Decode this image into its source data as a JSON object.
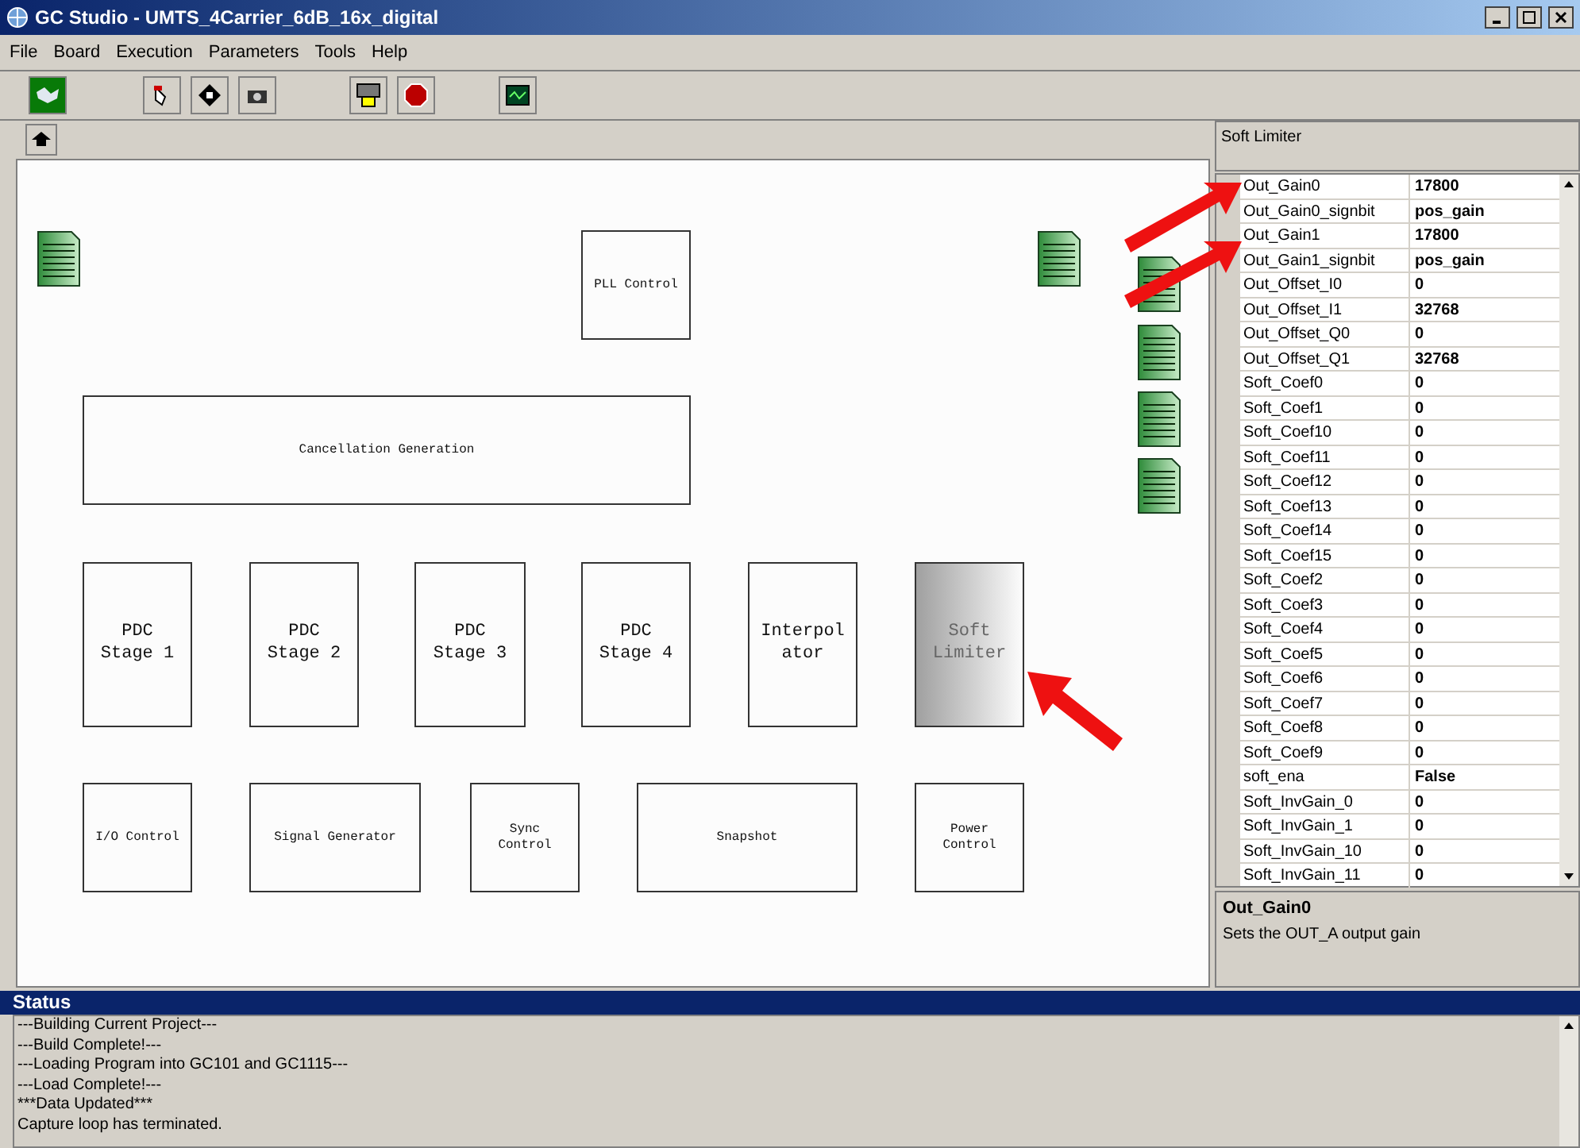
{
  "window": {
    "title": "GC Studio - UMTS_4Carrier_6dB_16x_digital"
  },
  "menu": [
    "File",
    "Board",
    "Execution",
    "Parameters",
    "Tools",
    "Help"
  ],
  "canvas": {
    "blocks": [
      {
        "kind": "small",
        "lines": [
          "PLL Control"
        ],
        "selected": false
      },
      {
        "kind": "small",
        "lines": [
          "Cancellation Generation"
        ],
        "selected": false
      },
      {
        "kind": "large",
        "lines": [
          "PDC",
          "Stage 1"
        ],
        "selected": false
      },
      {
        "kind": "large",
        "lines": [
          "PDC",
          "Stage 2"
        ],
        "selected": false
      },
      {
        "kind": "large",
        "lines": [
          "PDC",
          "Stage 3"
        ],
        "selected": false
      },
      {
        "kind": "large",
        "lines": [
          "PDC",
          "Stage 4"
        ],
        "selected": false
      },
      {
        "kind": "large",
        "lines": [
          "Interpol",
          "ator"
        ],
        "selected": false
      },
      {
        "kind": "large",
        "lines": [
          "Soft",
          "Limiter"
        ],
        "selected": true
      },
      {
        "kind": "small",
        "lines": [
          "I/O Control"
        ],
        "selected": false
      },
      {
        "kind": "small",
        "lines": [
          "Signal Generator"
        ],
        "selected": false
      },
      {
        "kind": "small",
        "lines": [
          "Sync",
          "Control"
        ],
        "selected": false
      },
      {
        "kind": "small",
        "lines": [
          "Snapshot"
        ],
        "selected": false
      },
      {
        "kind": "small",
        "lines": [
          "Power",
          "Control"
        ],
        "selected": false
      }
    ]
  },
  "properties": {
    "title": "Soft Limiter",
    "rows": [
      {
        "name": "Out_Gain0",
        "value": "17800"
      },
      {
        "name": "Out_Gain0_signbit",
        "value": "pos_gain"
      },
      {
        "name": "Out_Gain1",
        "value": "17800"
      },
      {
        "name": "Out_Gain1_signbit",
        "value": "pos_gain"
      },
      {
        "name": "Out_Offset_I0",
        "value": "0"
      },
      {
        "name": "Out_Offset_I1",
        "value": "32768"
      },
      {
        "name": "Out_Offset_Q0",
        "value": "0"
      },
      {
        "name": "Out_Offset_Q1",
        "value": "32768"
      },
      {
        "name": "Soft_Coef0",
        "value": "0"
      },
      {
        "name": "Soft_Coef1",
        "value": "0"
      },
      {
        "name": "Soft_Coef10",
        "value": "0"
      },
      {
        "name": "Soft_Coef11",
        "value": "0"
      },
      {
        "name": "Soft_Coef12",
        "value": "0"
      },
      {
        "name": "Soft_Coef13",
        "value": "0"
      },
      {
        "name": "Soft_Coef14",
        "value": "0"
      },
      {
        "name": "Soft_Coef15",
        "value": "0"
      },
      {
        "name": "Soft_Coef2",
        "value": "0"
      },
      {
        "name": "Soft_Coef3",
        "value": "0"
      },
      {
        "name": "Soft_Coef4",
        "value": "0"
      },
      {
        "name": "Soft_Coef5",
        "value": "0"
      },
      {
        "name": "Soft_Coef6",
        "value": "0"
      },
      {
        "name": "Soft_Coef7",
        "value": "0"
      },
      {
        "name": "Soft_Coef8",
        "value": "0"
      },
      {
        "name": "Soft_Coef9",
        "value": "0"
      },
      {
        "name": "soft_ena",
        "value": "False"
      },
      {
        "name": "Soft_InvGain_0",
        "value": "0"
      },
      {
        "name": "Soft_InvGain_1",
        "value": "0"
      },
      {
        "name": "Soft_InvGain_10",
        "value": "0"
      },
      {
        "name": "Soft_InvGain_11",
        "value": "0"
      }
    ],
    "description": {
      "title": "Out_Gain0",
      "text": "Sets the OUT_A output gain"
    }
  },
  "status": {
    "title": "Status",
    "lines": [
      "---Building Current Project---",
      "---Build Complete!---",
      "---Loading Program into GC101 and GC1115---",
      "---Load Complete!---",
      "***Data Updated***",
      "Capture loop has terminated."
    ]
  }
}
